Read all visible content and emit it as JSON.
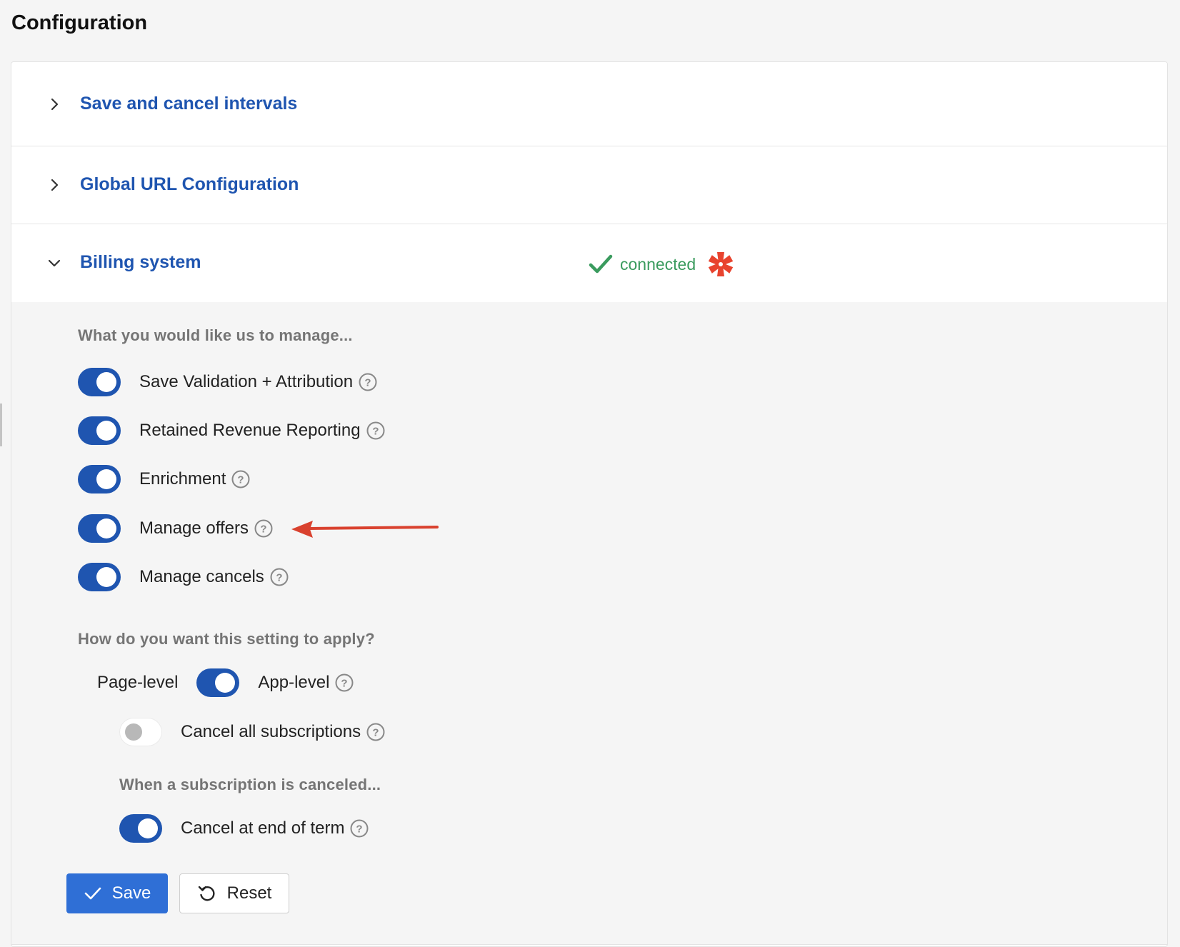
{
  "page": {
    "title": "Configuration"
  },
  "accordion": [
    {
      "title": "Save and cancel intervals",
      "expanded": false
    },
    {
      "title": "Global URL Configuration",
      "expanded": false
    },
    {
      "title": "Billing system",
      "expanded": true,
      "status_text": "connected",
      "status_color": "#3a9b5e"
    }
  ],
  "billing": {
    "manage_heading": "What you would like us to manage...",
    "features": [
      {
        "label": "Save Validation + Attribution",
        "enabled": true
      },
      {
        "label": "Retained Revenue Reporting",
        "enabled": true
      },
      {
        "label": "Enrichment",
        "enabled": true
      },
      {
        "label": "Manage offers",
        "enabled": true
      },
      {
        "label": "Manage cancels",
        "enabled": true
      }
    ],
    "apply_heading": "How do you want this setting to apply?",
    "level": {
      "left_label": "Page-level",
      "right_label": "App-level",
      "app_level": true
    },
    "cancel_all": {
      "label": "Cancel all subscriptions",
      "enabled": false
    },
    "canceled_heading": "When a subscription is canceled...",
    "cancel_end": {
      "label": "Cancel at end of term",
      "enabled": true
    }
  },
  "actions": {
    "save_label": "Save",
    "reset_label": "Reset"
  },
  "colors": {
    "accent": "#1f55b0",
    "primary_button": "#2f6fd6",
    "annotation_arrow": "#d9412e",
    "brand_logo": "#e8432e"
  },
  "icons": [
    "chevron-right-icon",
    "chevron-down-icon",
    "check-icon",
    "brand-logo",
    "help-icon",
    "reset-icon"
  ]
}
